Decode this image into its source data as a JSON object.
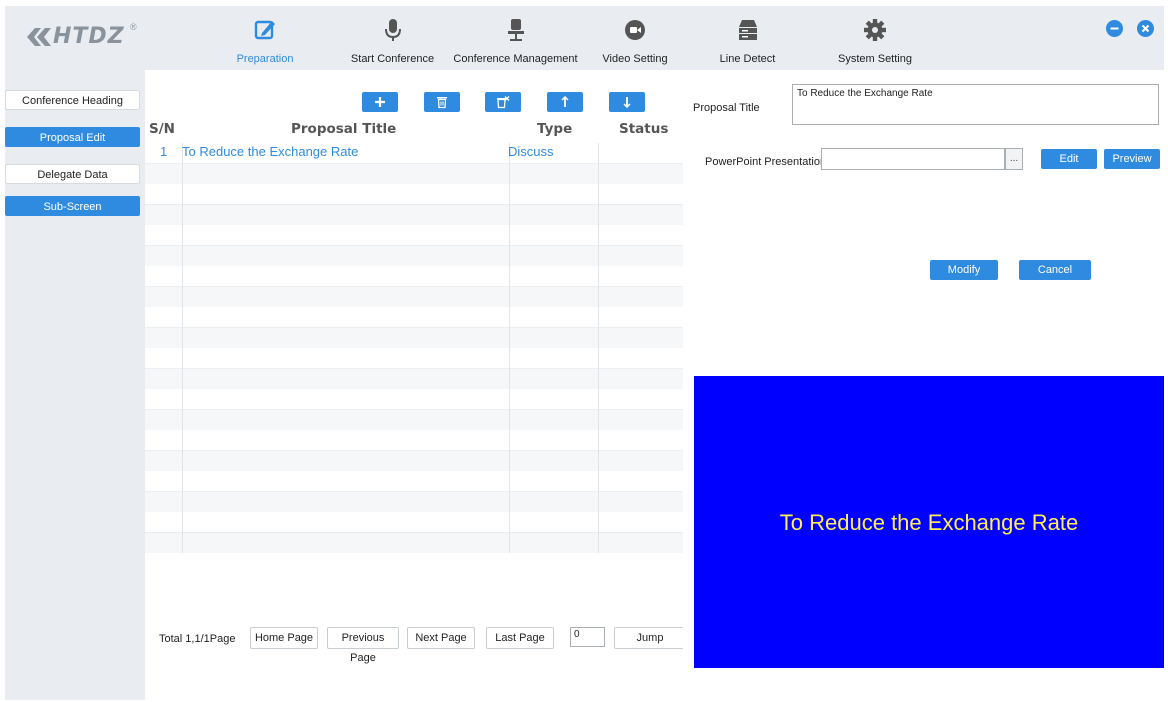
{
  "brand": {
    "logo_text": "HTDZ",
    "registered_mark": "®"
  },
  "nav": {
    "items": [
      {
        "label": "Preparation",
        "icon": "edit-icon",
        "active": true
      },
      {
        "label": "Start Conference",
        "icon": "microphone-icon",
        "active": false
      },
      {
        "label": "Conference Management",
        "icon": "chair-icon",
        "active": false
      },
      {
        "label": "Video Setting",
        "icon": "camera-icon",
        "active": false
      },
      {
        "label": "Line Detect",
        "icon": "server-icon",
        "active": false
      },
      {
        "label": "System Setting",
        "icon": "gear-icon",
        "active": false
      }
    ]
  },
  "window_controls": {
    "minimize_icon": "minimize-icon",
    "close_icon": "close-icon"
  },
  "sidebar": {
    "items": [
      {
        "label": "Conference Heading",
        "selected": false
      },
      {
        "label": "Proposal Edit",
        "selected": true
      },
      {
        "label": "Delegate Data",
        "selected": false
      },
      {
        "label": "Sub-Screen",
        "selected": true
      }
    ]
  },
  "toolbar": {
    "buttons": [
      "add-icon",
      "delete-icon",
      "clear-icon",
      "move-up-icon",
      "move-down-icon"
    ]
  },
  "proposal_list": {
    "columns": [
      "S/N",
      "Proposal Title",
      "Type",
      "Status"
    ],
    "rows": [
      {
        "sn": "1",
        "title": "To Reduce the Exchange Rate",
        "type": "Discuss",
        "status": ""
      }
    ]
  },
  "pager": {
    "total": "Total 1,1/1Page",
    "home": "Home Page",
    "previous": "Previous Page",
    "next": "Next Page",
    "last": "Last Page",
    "page_value": "0",
    "jump": "Jump"
  },
  "editor": {
    "title_label": "Proposal Title",
    "title_value": "To Reduce the Exchange Rate",
    "ppt_label": "PowerPoint Presentation",
    "ppt_value": "",
    "browse_label": "...",
    "edit_label": "Edit",
    "preview_label": "Preview",
    "modify_label": "Modify",
    "cancel_label": "Cancel"
  },
  "preview_screen": {
    "text": "To Reduce the Exchange Rate",
    "background": "#0000ff",
    "text_color": "#ffee55"
  },
  "colors": {
    "accent": "#2f8be0",
    "panel_bg": "#e9edf2"
  }
}
